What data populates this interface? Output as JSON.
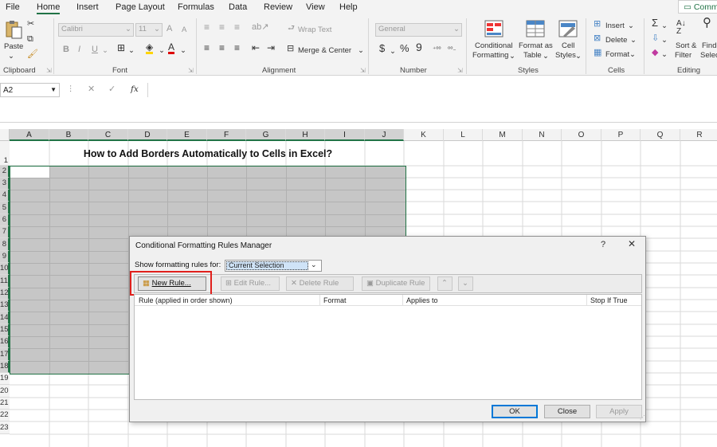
{
  "menu": {
    "tabs": [
      "File",
      "Home",
      "Insert",
      "Page Layout",
      "Formulas",
      "Data",
      "Review",
      "View",
      "Help"
    ],
    "active": "Home",
    "comments": "Comm"
  },
  "ribbon": {
    "clipboard": {
      "label": "Clipboard",
      "paste": "Paste"
    },
    "font": {
      "label": "Font",
      "name": "Calibri",
      "size": "11",
      "grow": "A",
      "shrink": "A",
      "bold": "B",
      "italic": "I",
      "underline": "U"
    },
    "alignment": {
      "label": "Alignment",
      "wrap": "Wrap Text",
      "merge": "Merge & Center"
    },
    "number": {
      "label": "Number",
      "format": "General",
      "currency": "$",
      "percent": "%",
      "comma": "9"
    },
    "styles": {
      "label": "Styles",
      "cf1": "Conditional",
      "cf2": "Formatting",
      "fat1": "Format as",
      "fat2": "Table",
      "cs1": "Cell",
      "cs2": "Styles"
    },
    "cells": {
      "label": "Cells",
      "insert": "Insert",
      "delete": "Delete",
      "format": "Format"
    },
    "editing": {
      "label": "Editing",
      "sort1": "Sort &",
      "sort2": "Filter",
      "find1": "Find",
      "find2": "Selec"
    }
  },
  "formula_bar": {
    "name_box": "A2",
    "fx": "fx",
    "cancel": "✕",
    "enter": "✓",
    "content": ""
  },
  "sheet": {
    "columns": [
      "A",
      "B",
      "C",
      "D",
      "E",
      "F",
      "G",
      "H",
      "I",
      "J",
      "K",
      "L",
      "M",
      "N",
      "O",
      "P",
      "Q",
      "R"
    ],
    "rows": [
      "1",
      "2",
      "3",
      "4",
      "5",
      "6",
      "7",
      "8",
      "9",
      "10",
      "11",
      "12",
      "13",
      "14",
      "15",
      "16",
      "17",
      "18",
      "19",
      "20",
      "21",
      "22",
      "23"
    ],
    "title": "How to Add Borders Automatically to Cells in Excel?"
  },
  "dialog": {
    "title": "Conditional Formatting Rules Manager",
    "help": "?",
    "close": "✕",
    "show_label": "Show formatting rules for:",
    "show_value": "Current Selection",
    "new_rule": "New Rule...",
    "edit_rule": "Edit Rule...",
    "delete_rule": "Delete Rule",
    "duplicate_rule": "Duplicate Rule",
    "columns": [
      "Rule (applied in order shown)",
      "Format",
      "Applies to",
      "Stop If True"
    ],
    "ok": "OK",
    "close_btn": "Close",
    "apply": "Apply",
    "highlight_color": "#e0201c"
  }
}
